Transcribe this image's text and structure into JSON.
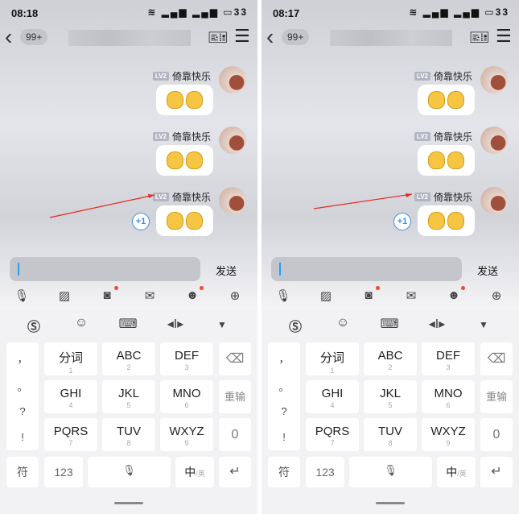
{
  "panels": [
    {
      "status": {
        "time": "08:18",
        "icons": "wifi-icon signal-icon signal-icon battery-icon",
        "battery": "33"
      },
      "header": {
        "unread": "99+"
      },
      "messages": [
        {
          "level": "LV2",
          "name": "倚靠快乐"
        },
        {
          "level": "LV2",
          "name": "倚靠快乐"
        },
        {
          "level": "LV2",
          "name": "倚靠快乐",
          "plus_one": "+1"
        }
      ],
      "send_label": "发送"
    },
    {
      "status": {
        "time": "08:17",
        "icons": "wifi-icon signal-icon signal-icon battery-icon",
        "battery": "33"
      },
      "header": {
        "unread": "99+"
      },
      "messages": [
        {
          "level": "LV2",
          "name": "倚靠快乐"
        },
        {
          "level": "LV2",
          "name": "倚靠快乐"
        },
        {
          "level": "LV2",
          "name": "倚靠快乐",
          "plus_one": "+1"
        }
      ],
      "send_label": "发送"
    }
  ],
  "keyboard": {
    "side_punct": [
      "，",
      "。",
      "?",
      "!"
    ],
    "keys": [
      {
        "main": "分词",
        "num": "1"
      },
      {
        "main": "ABC",
        "num": "2"
      },
      {
        "main": "DEF",
        "num": "3"
      },
      {
        "main": "GHI",
        "num": "4"
      },
      {
        "main": "JKL",
        "num": "5"
      },
      {
        "main": "MNO",
        "num": "6"
      },
      {
        "main": "PQRS",
        "num": "7"
      },
      {
        "main": "TUV",
        "num": "8"
      },
      {
        "main": "WXYZ",
        "num": "9"
      }
    ],
    "reinput": "重输",
    "zero": "0",
    "symbols": "符",
    "num_mode": "123",
    "lang_main": "中",
    "lang_alt": "/英"
  },
  "colors": {
    "accent": "#3a8ee6",
    "arrow": "#e8271f",
    "notify_dot": "#f04a2c"
  }
}
